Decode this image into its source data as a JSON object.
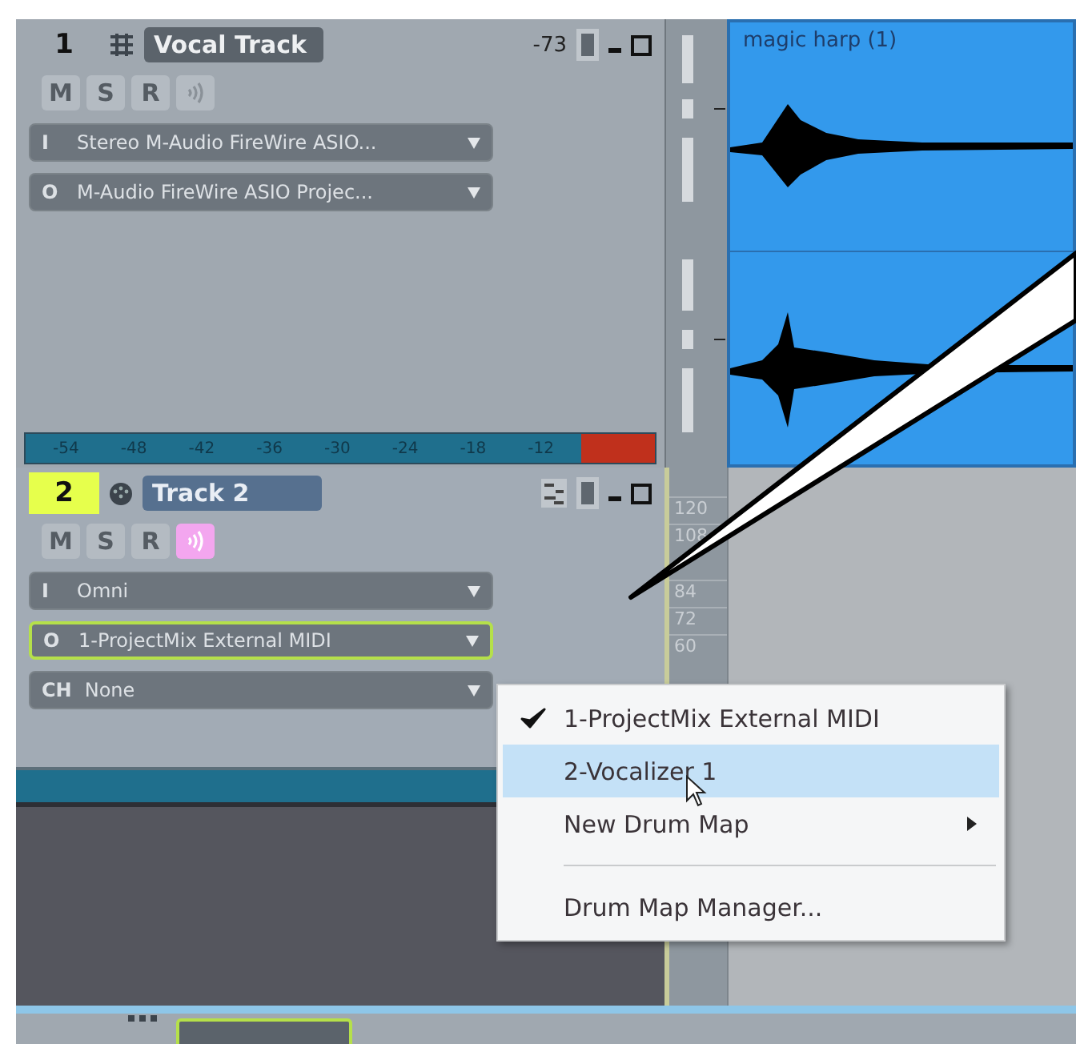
{
  "tracks": [
    {
      "number": "1",
      "kind": "audio",
      "name": "Vocal Track",
      "volume": "-73",
      "selected": false,
      "buttons": [
        {
          "kind": "text",
          "label": "M",
          "on": false
        },
        {
          "kind": "text",
          "label": "S",
          "on": false
        },
        {
          "kind": "text",
          "label": "R",
          "on": false
        },
        {
          "kind": "echo",
          "on": false
        }
      ],
      "routes": [
        {
          "prefix": "I",
          "value": "Stereo M-Audio FireWire ASIO...",
          "focused": false
        },
        {
          "prefix": "O",
          "value": "M-Audio FireWire ASIO Projec...",
          "focused": false
        }
      ],
      "meter_ticks": [
        "-54",
        "-48",
        "-42",
        "-36",
        "-30",
        "-24",
        "-18",
        "-12"
      ]
    },
    {
      "number": "2",
      "kind": "midi",
      "name": "Track 2",
      "selected": true,
      "buttons": [
        {
          "kind": "text",
          "label": "M",
          "on": false
        },
        {
          "kind": "text",
          "label": "S",
          "on": false
        },
        {
          "kind": "text",
          "label": "R",
          "on": false
        },
        {
          "kind": "echo",
          "on": true
        }
      ],
      "routes": [
        {
          "prefix": "I",
          "value": "Omni",
          "focused": false
        },
        {
          "prefix": "O",
          "value": "1-ProjectMix External MIDI",
          "focused": true
        },
        {
          "prefix": "CH",
          "value": "None",
          "focused": false
        }
      ],
      "ruler": [
        "120",
        "108",
        "84",
        "72",
        "60"
      ]
    }
  ],
  "clip": {
    "title": "magic harp (1)"
  },
  "menu": {
    "items": [
      {
        "kind": "item",
        "label": "1-ProjectMix External MIDI",
        "checked": true,
        "selected": false,
        "submenu": false
      },
      {
        "kind": "item",
        "label": "2-Vocalizer 1",
        "checked": false,
        "selected": true,
        "submenu": false
      },
      {
        "kind": "item",
        "label": "New Drum Map",
        "checked": false,
        "selected": false,
        "submenu": true
      },
      {
        "kind": "separator"
      },
      {
        "kind": "item",
        "label": "Drum Map Manager...",
        "checked": false,
        "selected": false,
        "submenu": false
      }
    ]
  }
}
